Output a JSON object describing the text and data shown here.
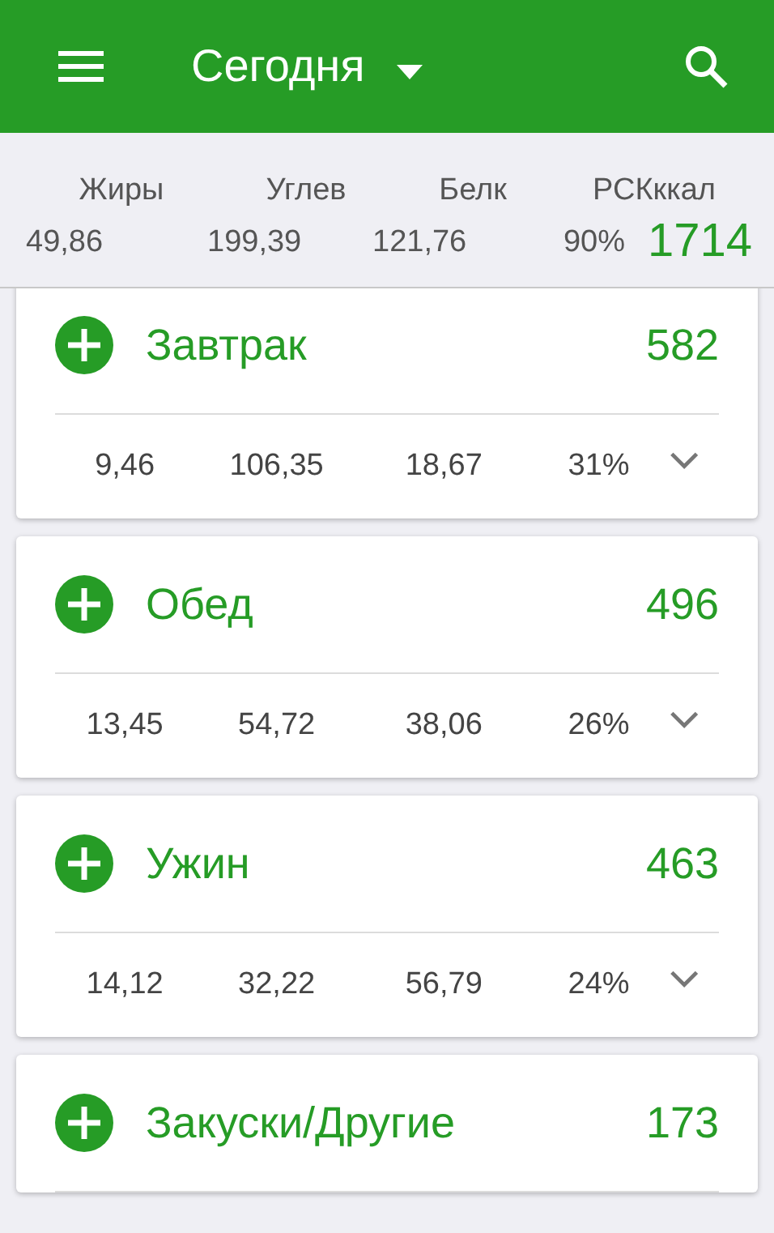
{
  "app_bar": {
    "title": "Сегодня"
  },
  "summary": {
    "labels": [
      "Жиры",
      "Углев",
      "Белк",
      "РСКккал"
    ],
    "values": [
      "49,86",
      "199,39",
      "121,76",
      "90%"
    ],
    "kcal": "1714"
  },
  "meals": [
    {
      "name": "Завтрак",
      "kcal": "582",
      "macros": [
        "9,46",
        "106,35",
        "18,67",
        "31%"
      ]
    },
    {
      "name": "Обед",
      "kcal": "496",
      "macros": [
        "13,45",
        "54,72",
        "38,06",
        "26%"
      ]
    },
    {
      "name": "Ужин",
      "kcal": "463",
      "macros": [
        "14,12",
        "32,22",
        "56,79",
        "24%"
      ]
    },
    {
      "name": "Закуски/Другие",
      "kcal": "173"
    }
  ]
}
